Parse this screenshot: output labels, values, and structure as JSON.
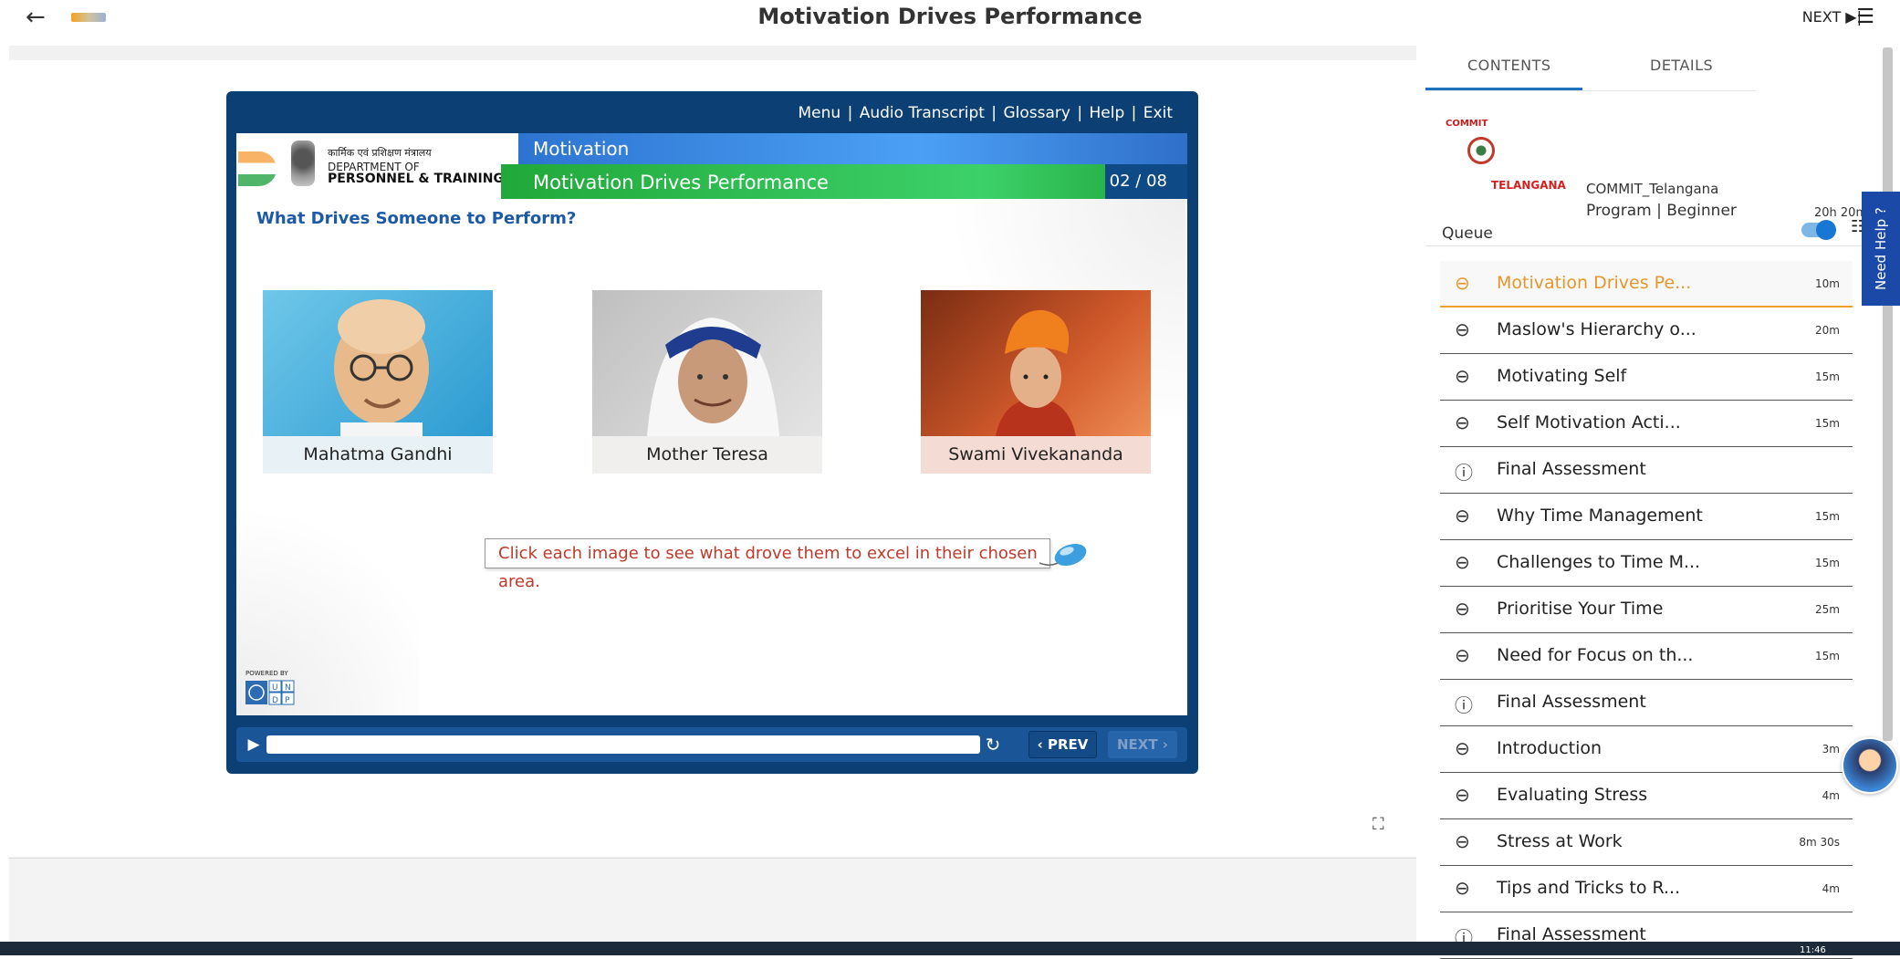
{
  "header": {
    "title": "Motivation Drives Performance",
    "next_label": "NEXT ▶|",
    "back_icon": "arrow-left-icon",
    "menu_icon": "hamburger-icon"
  },
  "player": {
    "links": [
      "Menu",
      "Audio Transcript",
      "Glossary",
      "Help",
      "Exit"
    ],
    "dept_hindi": "कार्मिक एवं प्रशिक्षण मंत्रालय",
    "dept_line1": "DEPARTMENT OF",
    "dept_line2": "PERSONNEL & TRAINING",
    "module": "Motivation",
    "topic": "Motivation Drives Performance",
    "page_count": "02 / 08",
    "question": "What Drives Someone to Perform?",
    "people": [
      "Mahatma Gandhi",
      "Mother Teresa",
      "Swami Vivekananda"
    ],
    "instruction": "Click each image to see what drove them to excel in their chosen area.",
    "powered_by": "POWERED BY",
    "prev_label": "‹ PREV",
    "next_label": "NEXT ›",
    "progress_fraction": 1.0
  },
  "panel": {
    "tabs": [
      "CONTENTS",
      "DETAILS"
    ],
    "active_tab": "CONTENTS",
    "program_name": "COMMIT_Telangana",
    "program_meta": "Program | Beginner",
    "program_duration": "20h 20m",
    "logo_top_text": "COMMIT",
    "logo_bottom_text": "TELANGANA",
    "queue_label": "Queue",
    "queue": [
      {
        "title": "Motivation Drives Pe...",
        "duration": "10m",
        "icon": "link-icon",
        "active": true
      },
      {
        "title": "Maslow's Hierarchy o...",
        "duration": "20m",
        "icon": "link-icon"
      },
      {
        "title": "Motivating Self",
        "duration": "15m",
        "icon": "link-icon"
      },
      {
        "title": "Self Motivation Acti...",
        "duration": "15m",
        "icon": "link-icon"
      },
      {
        "title": "Final Assessment",
        "duration": "",
        "icon": "question-icon"
      },
      {
        "title": "Why Time Management",
        "duration": "15m",
        "icon": "link-icon"
      },
      {
        "title": "Challenges to Time M...",
        "duration": "15m",
        "icon": "link-icon"
      },
      {
        "title": "Prioritise Your Time",
        "duration": "25m",
        "icon": "link-icon"
      },
      {
        "title": "Need for Focus on th...",
        "duration": "15m",
        "icon": "link-icon"
      },
      {
        "title": "Final Assessment",
        "duration": "",
        "icon": "question-icon"
      },
      {
        "title": "Introduction",
        "duration": "3m",
        "icon": "link-icon"
      },
      {
        "title": "Evaluating Stress",
        "duration": "4m",
        "icon": "link-icon"
      },
      {
        "title": "Stress at Work",
        "duration": "8m 30s",
        "icon": "link-icon"
      },
      {
        "title": "Tips and Tricks to R...",
        "duration": "4m",
        "icon": "link-icon"
      },
      {
        "title": "Final Assessment",
        "duration": "",
        "icon": "question-icon"
      }
    ],
    "need_help": "Need Help ?"
  },
  "taskbar": {
    "clock": "11:46"
  },
  "colors": {
    "accent_orange": "#e8962c",
    "player_navy": "#0c3f73",
    "tab_blue": "#1e73be",
    "help_blue": "#1a49a8"
  }
}
